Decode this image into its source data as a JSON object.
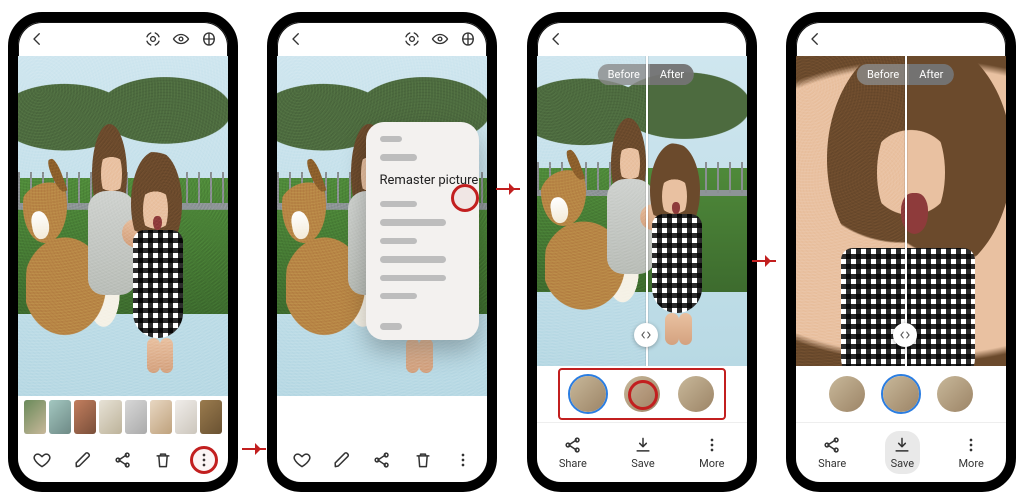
{
  "screens": {
    "s1": {
      "top_icons": [
        "bixby-vision-icon",
        "eye-icon",
        "ar-icon"
      ]
    },
    "s2": {
      "menu": {
        "remaster_label": "Remaster picture"
      }
    },
    "compare": {
      "before_label": "Before",
      "after_label": "After"
    },
    "actions": {
      "share_label": "Share",
      "save_label": "Save",
      "more_label": "More"
    }
  },
  "colors": {
    "accent": "#c21f1f",
    "selection": "#2a7de1"
  },
  "suggestions": {
    "count": 3,
    "selected_index": 0,
    "highlight_index_s3": 1
  }
}
